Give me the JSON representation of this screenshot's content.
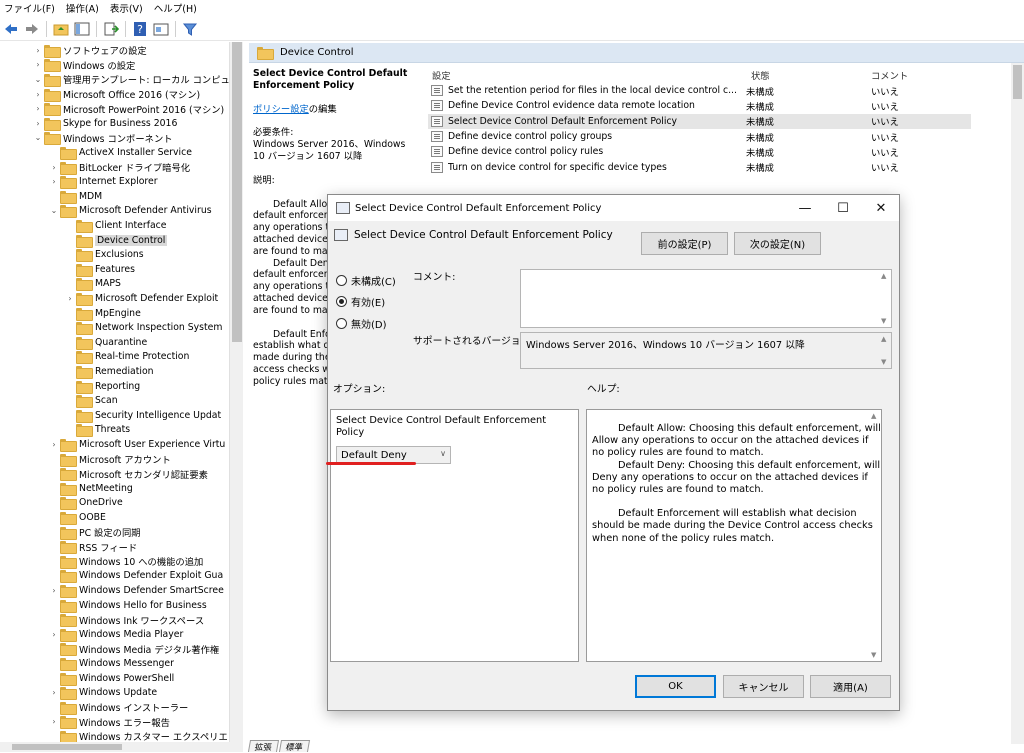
{
  "menu": [
    "ファイル(F)",
    "操作(A)",
    "表示(V)",
    "ヘルプ(H)"
  ],
  "tree": [
    {
      "label": "ソフトウェアの設定",
      "expander": "›",
      "indent": 1
    },
    {
      "label": "Windows の設定",
      "expander": "›",
      "indent": 1
    },
    {
      "label": "管理用テンプレート: ローカル コンピューターが",
      "expander": "⌄",
      "indent": 1
    },
    {
      "label": "Microsoft Office 2016 (マシン)",
      "expander": "›",
      "indent": 2
    },
    {
      "label": "Microsoft PowerPoint 2016 (マシン)",
      "expander": "›",
      "indent": 2
    },
    {
      "label": "Skype for Business 2016",
      "expander": "›",
      "indent": 2
    },
    {
      "label": "Windows コンポーネント",
      "expander": "⌄",
      "indent": 2
    },
    {
      "label": "ActiveX Installer Service",
      "expander": "",
      "indent": 3
    },
    {
      "label": "BitLocker ドライブ暗号化",
      "expander": "›",
      "indent": 3
    },
    {
      "label": "Internet Explorer",
      "expander": "›",
      "indent": 3
    },
    {
      "label": "MDM",
      "expander": "",
      "indent": 3
    },
    {
      "label": "Microsoft Defender Antivirus",
      "expander": "⌄",
      "indent": 3
    },
    {
      "label": "Client Interface",
      "expander": "",
      "indent": 4
    },
    {
      "label": "Device Control",
      "expander": "",
      "indent": 4,
      "selected": true
    },
    {
      "label": "Exclusions",
      "expander": "",
      "indent": 4
    },
    {
      "label": "Features",
      "expander": "",
      "indent": 4
    },
    {
      "label": "MAPS",
      "expander": "",
      "indent": 4
    },
    {
      "label": "Microsoft Defender Exploit",
      "expander": "›",
      "indent": 4
    },
    {
      "label": "MpEngine",
      "expander": "",
      "indent": 4
    },
    {
      "label": "Network Inspection System",
      "expander": "",
      "indent": 4
    },
    {
      "label": "Quarantine",
      "expander": "",
      "indent": 4
    },
    {
      "label": "Real-time Protection",
      "expander": "",
      "indent": 4
    },
    {
      "label": "Remediation",
      "expander": "",
      "indent": 4
    },
    {
      "label": "Reporting",
      "expander": "",
      "indent": 4
    },
    {
      "label": "Scan",
      "expander": "",
      "indent": 4
    },
    {
      "label": "Security Intelligence Updat",
      "expander": "",
      "indent": 4
    },
    {
      "label": "Threats",
      "expander": "",
      "indent": 4
    },
    {
      "label": "Microsoft User Experience Virtu",
      "expander": "›",
      "indent": 3
    },
    {
      "label": "Microsoft アカウント",
      "expander": "",
      "indent": 3
    },
    {
      "label": "Microsoft セカンダリ認証要素",
      "expander": "",
      "indent": 3
    },
    {
      "label": "NetMeeting",
      "expander": "",
      "indent": 3
    },
    {
      "label": "OneDrive",
      "expander": "",
      "indent": 3
    },
    {
      "label": "OOBE",
      "expander": "",
      "indent": 3
    },
    {
      "label": "PC 設定の同期",
      "expander": "",
      "indent": 3
    },
    {
      "label": "RSS フィード",
      "expander": "",
      "indent": 3
    },
    {
      "label": "Windows 10 への機能の追加",
      "expander": "",
      "indent": 3
    },
    {
      "label": "Windows Defender Exploit Gua",
      "expander": "",
      "indent": 3
    },
    {
      "label": "Windows Defender SmartScree",
      "expander": "›",
      "indent": 3
    },
    {
      "label": "Windows Hello for Business",
      "expander": "",
      "indent": 3
    },
    {
      "label": "Windows Ink ワークスペース",
      "expander": "",
      "indent": 3
    },
    {
      "label": "Windows Media Player",
      "expander": "›",
      "indent": 3
    },
    {
      "label": "Windows Media デジタル著作権",
      "expander": "",
      "indent": 3
    },
    {
      "label": "Windows Messenger",
      "expander": "",
      "indent": 3
    },
    {
      "label": "Windows PowerShell",
      "expander": "",
      "indent": 3
    },
    {
      "label": "Windows Update",
      "expander": "›",
      "indent": 3
    },
    {
      "label": "Windows インストーラー",
      "expander": "",
      "indent": 3
    },
    {
      "label": "Windows エラー報告",
      "expander": "›",
      "indent": 3
    },
    {
      "label": "Windows カスタマー エクスペリエン",
      "expander": "",
      "indent": 3
    }
  ],
  "pane": {
    "header": "Device Control",
    "policy_title": "Select Device Control Default Enforcement Policy",
    "edit_link": "ポリシー設定",
    "edit_suffix": "の編集",
    "req_label": "必要条件:",
    "req_value": "Windows Server 2016、Windows 10 バージョン 1607 以降",
    "desc_label": "説明:",
    "desc_body": [
      "Default Allow: Choosing this default enforcement, will Allow any operations to occur on the attached devices if no policy rules are found to match.",
      "Default Deny: Choosing this default enforcement, will Deny any operations to occur on the attached devices if no policy rules are found to match.",
      "Default Enforcement will establish what decision should be made during the Device Control access checks when none of the policy rules match."
    ],
    "columns": {
      "setting": "設定",
      "state": "状態",
      "comment": "コメント"
    },
    "rows": [
      {
        "name": "Set the retention period for files in the local device control c...",
        "state": "未構成",
        "comment": "いいえ"
      },
      {
        "name": "Define Device Control evidence data remote location",
        "state": "未構成",
        "comment": "いいえ"
      },
      {
        "name": "Select Device Control Default Enforcement Policy",
        "state": "未構成",
        "comment": "いいえ",
        "selected": true
      },
      {
        "name": "Define device control policy groups",
        "state": "未構成",
        "comment": "いいえ"
      },
      {
        "name": "Define device control policy rules",
        "state": "未構成",
        "comment": "いいえ"
      },
      {
        "name": "Turn on device control for specific device types",
        "state": "未構成",
        "comment": "いいえ"
      }
    ],
    "tabs": [
      "拡張",
      "標準"
    ]
  },
  "dialog": {
    "title": "Select Device Control Default Enforcement Policy",
    "heading": "Select Device Control Default Enforcement Policy",
    "prev_button": "前の設定(P)",
    "next_button": "次の設定(N)",
    "radio_not_configured": "未構成(C)",
    "radio_enabled": "有効(E)",
    "radio_disabled": "無効(D)",
    "selected_radio": "enabled",
    "comment_label": "コメント:",
    "supported_label": "サポートされるバージョン:",
    "supported_value": "Windows Server 2016、Windows 10 バージョン 1607 以降",
    "options_label": "オプション:",
    "help_label": "ヘルプ:",
    "option_field_label": "Select Device Control Default Enforcement Policy",
    "option_value": "Default Deny",
    "help_paragraphs": [
      "Default Allow: Choosing this default enforcement, will Allow any operations to occur on the attached devices if no policy rules are found to match.",
      "Default Deny: Choosing this default enforcement, will Deny any operations to occur on the attached devices if no policy rules are found to match.",
      "",
      "Default Enforcement will establish what decision should be made during the Device Control access checks when none of the policy rules match."
    ],
    "ok_button": "OK",
    "cancel_button": "キャンセル",
    "apply_button": "適用(A)"
  },
  "colors": {
    "accent": "#0078d7",
    "header_bg": "#dce7f3",
    "folder": "#f2c55c",
    "annotation": "#e02020"
  }
}
